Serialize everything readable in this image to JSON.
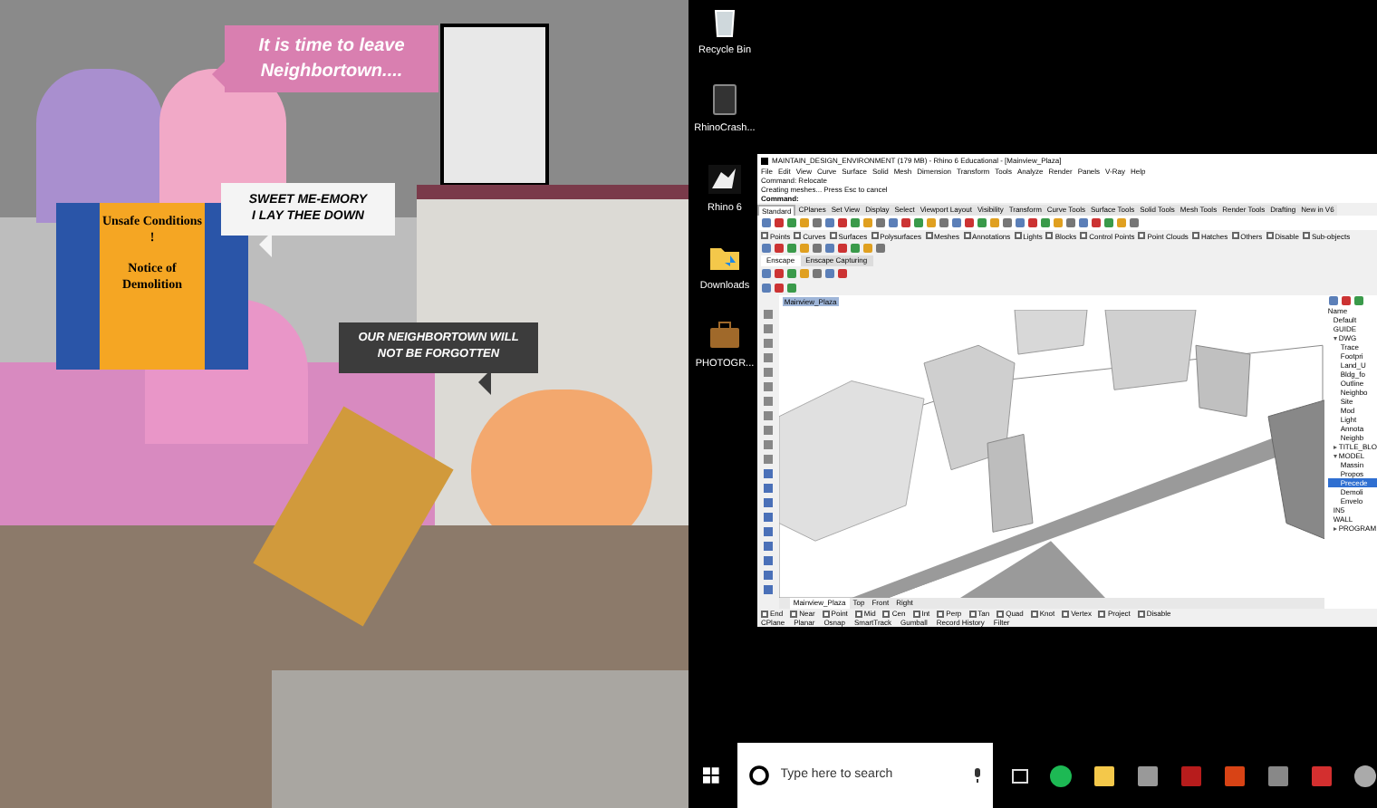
{
  "collage": {
    "bubbles": [
      {
        "kind": "pink",
        "lines": [
          "It is time to leave",
          "Neighbortown...."
        ]
      },
      {
        "kind": "light",
        "lines": [
          "SWEET ME-EMORY",
          "I LAY THEE DOWN"
        ]
      },
      {
        "kind": "dark",
        "lines": [
          "OUR NEIGHBORTOWN WILL",
          "NOT BE FORGOTTEN"
        ]
      }
    ],
    "sign": {
      "lines": [
        "Unsafe Conditions !",
        "Notice of Demolition"
      ]
    }
  },
  "desktop_icons": [
    {
      "label": "Recycle Bin",
      "kind": "bin"
    },
    {
      "label": "RhinoCrash...",
      "kind": "file"
    },
    {
      "label": "Rhino 6",
      "kind": "rhino"
    },
    {
      "label": "Downloads",
      "kind": "folder"
    },
    {
      "label": "PHOTOGR...",
      "kind": "case"
    }
  ],
  "rhino": {
    "title": "MAINTAIN_DESIGN_ENVIRONMENT (179 MB) - Rhino 6 Educational - [Mainview_Plaza]",
    "menu": [
      "File",
      "Edit",
      "View",
      "Curve",
      "Surface",
      "Solid",
      "Mesh",
      "Dimension",
      "Transform",
      "Tools",
      "Analyze",
      "Render",
      "Panels",
      "V-Ray",
      "Help"
    ],
    "command_lines": [
      "Command: Relocate",
      "Creating meshes... Press Esc to cancel"
    ],
    "command_prompt": "Command:",
    "toolbar_tabs": [
      {
        "label": "Standard",
        "selected": true
      },
      {
        "label": "CPlanes",
        "selected": false
      },
      {
        "label": "Set View",
        "selected": false
      },
      {
        "label": "Display",
        "selected": false
      },
      {
        "label": "Select",
        "selected": false
      },
      {
        "label": "Viewport Layout",
        "selected": false
      },
      {
        "label": "Visibility",
        "selected": false
      },
      {
        "label": "Transform",
        "selected": false
      },
      {
        "label": "Curve Tools",
        "selected": false
      },
      {
        "label": "Surface Tools",
        "selected": false
      },
      {
        "label": "Solid Tools",
        "selected": false
      },
      {
        "label": "Mesh Tools",
        "selected": false
      },
      {
        "label": "Render Tools",
        "selected": false
      },
      {
        "label": "Drafting",
        "selected": false
      },
      {
        "label": "New in V6",
        "selected": false
      }
    ],
    "filters": [
      {
        "label": "Points",
        "checked": false
      },
      {
        "label": "Curves",
        "checked": false
      },
      {
        "label": "Surfaces",
        "checked": false
      },
      {
        "label": "Polysurfaces",
        "checked": false
      },
      {
        "label": "Meshes",
        "checked": false
      },
      {
        "label": "Annotations",
        "checked": false
      },
      {
        "label": "Lights",
        "checked": false
      },
      {
        "label": "Blocks",
        "checked": false
      },
      {
        "label": "Control Points",
        "checked": false
      },
      {
        "label": "Point Clouds",
        "checked": false
      },
      {
        "label": "Hatches",
        "checked": false
      },
      {
        "label": "Others",
        "checked": false
      },
      {
        "label": "Disable",
        "checked": false
      },
      {
        "label": "Sub-objects",
        "checked": false
      }
    ],
    "plugin_tabs": [
      {
        "label": "Enscape",
        "selected": true
      },
      {
        "label": "Enscape Capturing",
        "selected": false
      }
    ],
    "viewport_title": "Mainview_Plaza",
    "view_tabs": [
      {
        "label": "Mainview_Plaza",
        "selected": true
      },
      {
        "label": "Top",
        "selected": false
      },
      {
        "label": "Front",
        "selected": false
      },
      {
        "label": "Right",
        "selected": false
      }
    ],
    "layers": {
      "header": "Name",
      "items": [
        {
          "name": "Default",
          "selected": false
        },
        {
          "name": "GUIDE",
          "selected": false
        },
        {
          "name": "DWG",
          "selected": false,
          "expanded": true,
          "children": [
            {
              "name": "Trace",
              "selected": false
            },
            {
              "name": "Footpri",
              "selected": false
            },
            {
              "name": "Land_U",
              "selected": false
            },
            {
              "name": "Bldg_fo",
              "selected": false
            },
            {
              "name": "Outline",
              "selected": false
            },
            {
              "name": "Neighbo",
              "selected": false
            },
            {
              "name": "Site",
              "selected": false
            },
            {
              "name": "Mod",
              "selected": false
            },
            {
              "name": "Light",
              "selected": false
            },
            {
              "name": "Annota",
              "selected": false
            },
            {
              "name": "Neighb",
              "selected": false
            }
          ]
        },
        {
          "name": "TITLE_BLO",
          "selected": false,
          "expanded": false
        },
        {
          "name": "MODEL",
          "selected": false,
          "expanded": true,
          "children": [
            {
              "name": "Massin",
              "selected": false
            },
            {
              "name": "Propos",
              "selected": false
            },
            {
              "name": "Precede",
              "selected": true
            },
            {
              "name": "Demoli",
              "selected": false
            },
            {
              "name": "Envelo",
              "selected": false
            }
          ]
        },
        {
          "name": "IN5",
          "selected": false
        },
        {
          "name": "WALL",
          "selected": false
        },
        {
          "name": "PROGRAM",
          "selected": false,
          "expanded": false
        }
      ]
    },
    "osnaps": [
      {
        "label": "End",
        "checked": false
      },
      {
        "label": "Near",
        "checked": false
      },
      {
        "label": "Point",
        "checked": false
      },
      {
        "label": "Mid",
        "checked": false
      },
      {
        "label": "Cen",
        "checked": false
      },
      {
        "label": "Int",
        "checked": false
      },
      {
        "label": "Perp",
        "checked": false
      },
      {
        "label": "Tan",
        "checked": false
      },
      {
        "label": "Quad",
        "checked": false
      },
      {
        "label": "Knot",
        "checked": false
      },
      {
        "label": "Vertex",
        "checked": false
      },
      {
        "label": "Project",
        "checked": false
      },
      {
        "label": "Disable",
        "checked": false
      }
    ],
    "status_items": [
      "CPlane",
      "Planar",
      "Osnap",
      "SmartTrack",
      "Gumball",
      "Record History",
      "Filter"
    ]
  },
  "taskbar": {
    "search_placeholder": "Type here to search"
  }
}
